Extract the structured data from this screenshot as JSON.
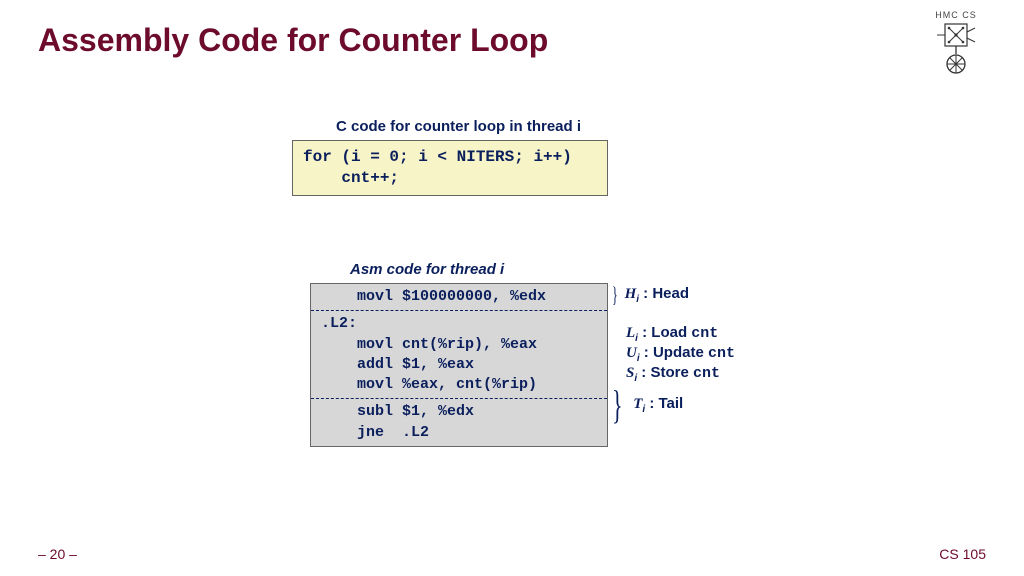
{
  "title": "Assembly Code for Counter Loop",
  "logo": {
    "text": "HMC  CS"
  },
  "c": {
    "caption": "C code for counter loop in thread i",
    "line1": "for (i = 0; i < NITERS; i++)",
    "line2": "    cnt++;"
  },
  "asm": {
    "caption": "Asm code for thread i",
    "head": "    movl $100000000, %edx",
    "label": ".L2:",
    "load": "    movl cnt(%rip), %eax",
    "upd": "    addl $1, %eax",
    "store": "    movl %eax, cnt(%rip)",
    "tail1": "    subl $1, %edx",
    "tail2": "    jne  .L2"
  },
  "ann": {
    "head": {
      "sym": "H",
      "sub": "i",
      "rest": " : Head"
    },
    "load": {
      "sym": "L",
      "sub": "i",
      "rest": " : Load ",
      "mono": "cnt"
    },
    "update": {
      "sym": "U",
      "sub": "i",
      "rest": " : Update ",
      "mono": "cnt"
    },
    "store": {
      "sym": "S",
      "sub": "i",
      "rest": " : Store ",
      "mono": "cnt"
    },
    "tail": {
      "sym": "T",
      "sub": "i",
      "rest": " : Tail"
    }
  },
  "footer": {
    "page": "– 20 –",
    "course": "CS 105"
  }
}
